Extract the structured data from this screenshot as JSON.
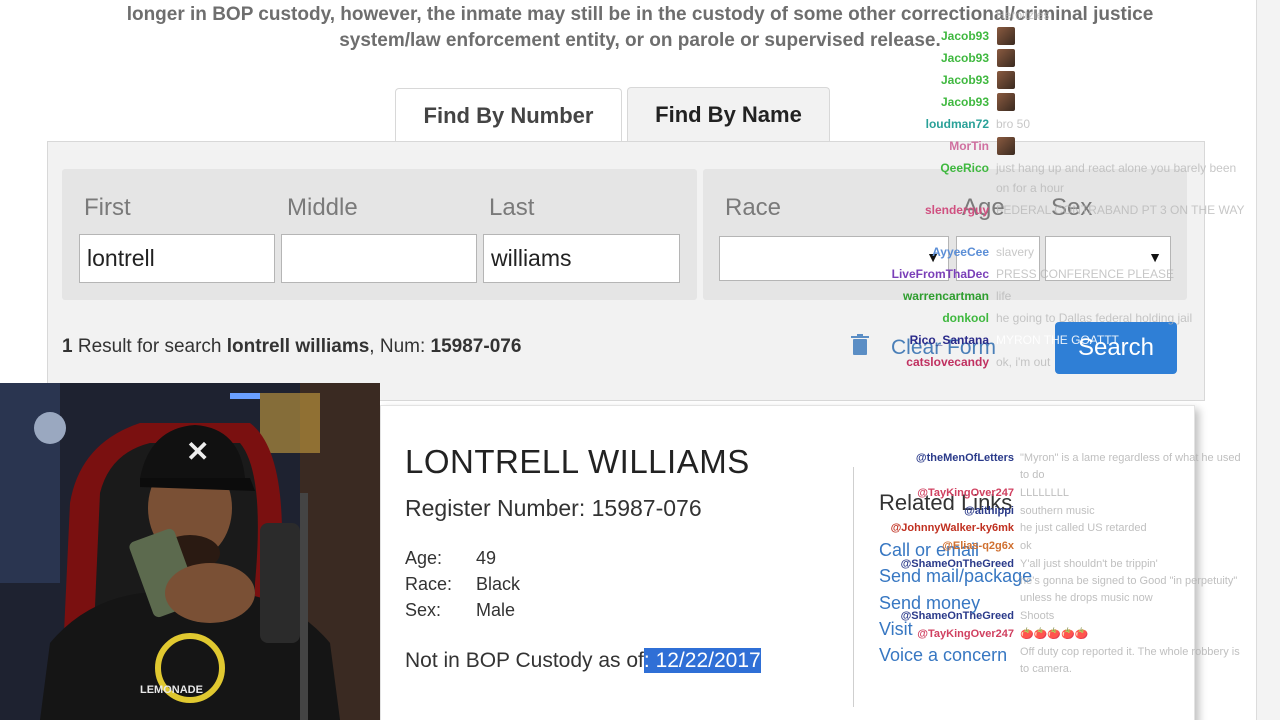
{
  "notice": {
    "line1": "longer in BOP custody, however, the inmate may still be in the custody of some other correctional/criminal justice",
    "line2": "system/law enforcement entity, or on parole or supervised release."
  },
  "tabs": [
    {
      "label": "Find By Number"
    },
    {
      "label": "Find By Name"
    }
  ],
  "search": {
    "first_label": "First",
    "middle_label": "Middle",
    "last_label": "Last",
    "race_label": "Race",
    "age_label": "Age",
    "sex_label": "Sex",
    "first_value": "lontrell",
    "middle_value": "",
    "last_value": "williams",
    "clear_label": "Clear Form",
    "search_label": "Search"
  },
  "result_summary": {
    "count": "1",
    "text1": " Result for search ",
    "query": "lontrell williams",
    "text2": ", Num: ",
    "num": "15987-076"
  },
  "inmate": {
    "name": "LONTRELL WILLIAMS",
    "register": "Register Number: 15987-076",
    "age_label": "Age:",
    "age": "49",
    "race_label": "Race:",
    "race": "Black",
    "sex_label": "Sex:",
    "sex": "Male",
    "custody_prefix": "Not in BOP Custody as of",
    "custody_date": ": 12/22/2017"
  },
  "related": {
    "title": "Related Links",
    "links": [
      "Call or email",
      "Send mail/package",
      "Send money",
      "Visit",
      "Voice a concern"
    ]
  },
  "chat_top": [
    {
      "user": "",
      "msg": "Heroitzies",
      "color": "#b0b0b0"
    },
    {
      "user": "Jacob93",
      "msg": "",
      "color": "#3fb83f"
    },
    {
      "user": "Jacob93",
      "msg": "",
      "color": "#3fb83f"
    },
    {
      "user": "Jacob93",
      "msg": "",
      "color": "#3fb83f"
    },
    {
      "user": "Jacob93",
      "msg": "",
      "color": "#3fb83f"
    },
    {
      "user": "loudman72",
      "msg": "bro 50",
      "color": "#2aa198"
    },
    {
      "user": "MorTin",
      "msg": "",
      "color": "#d070a0"
    },
    {
      "user": "QeeRico",
      "msg": "just hang up and react alone you barely been",
      "color": "#3fb83f"
    },
    {
      "user": "",
      "msg": "on for a hour",
      "color": "#3fb83f"
    },
    {
      "user": "slenderguy",
      "msg": "FEDERAL CONTRABAND PT 3 ON THE WAY",
      "color": "#d05080"
    },
    {
      "user": "AyyeeCee",
      "msg": "slavery",
      "color": "#5b8ed6"
    },
    {
      "user": "LiveFromThaDec",
      "msg": "PRESS CONFERENCE PLEASE",
      "color": "#7a3fb8"
    },
    {
      "user": "warrencartman",
      "msg": "life",
      "color": "#2e9e2e"
    },
    {
      "user": "donkool",
      "msg": "he going to Dallas federal holding jail",
      "color": "#3fb83f"
    },
    {
      "user": "Rico_Santana",
      "msg": "MYRON THE GOATTT",
      "color": "#2a2a8a"
    },
    {
      "user": "catslovecandy",
      "msg": "ok, i'm out",
      "color": "#c03060"
    }
  ],
  "chat_bottom": [
    {
      "user": "@theMenOfLetters",
      "msg": "\"Myron\" is a lame regardless of what he used",
      "color": "#2a3a8a"
    },
    {
      "user": "",
      "msg": "to do",
      "color": "#2a3a8a"
    },
    {
      "user": "@TayKingOver247",
      "msg": "LLLLLLLL",
      "color": "#d04060"
    },
    {
      "user": "@aithippi",
      "msg": "southern music",
      "color": "#2a3a8a"
    },
    {
      "user": "@JohnnyWalker-ky6mk",
      "msg": "he just called US retarded",
      "color": "#c03020"
    },
    {
      "user": "@Elias-q2g6x",
      "msg": "ok",
      "color": "#d07030"
    },
    {
      "user": "@ShameOnTheGreed",
      "msg": "Y'all just shouldn't be trippin'",
      "color": "#2a3a8a"
    },
    {
      "user": "",
      "msg": "he's gonna be signed to Good \"in perpetuity\"",
      "color": "#3fb83f"
    },
    {
      "user": "",
      "msg": "unless he drops music now",
      "color": "#3fb83f"
    },
    {
      "user": "@ShameOnTheGreed",
      "msg": "Shoots",
      "color": "#2a3a8a"
    },
    {
      "user": "@TayKingOver247",
      "msg": "🍅🍅🍅🍅🍅",
      "color": "#d04060"
    },
    {
      "user": "",
      "msg": "Off duty cop reported it. The whole robbery is",
      "color": "#3fb83f"
    },
    {
      "user": "",
      "msg": "to camera.",
      "color": "#3fb83f"
    }
  ],
  "webcam": {
    "hat_text": "X",
    "shirt_text": "LEMONADE"
  }
}
